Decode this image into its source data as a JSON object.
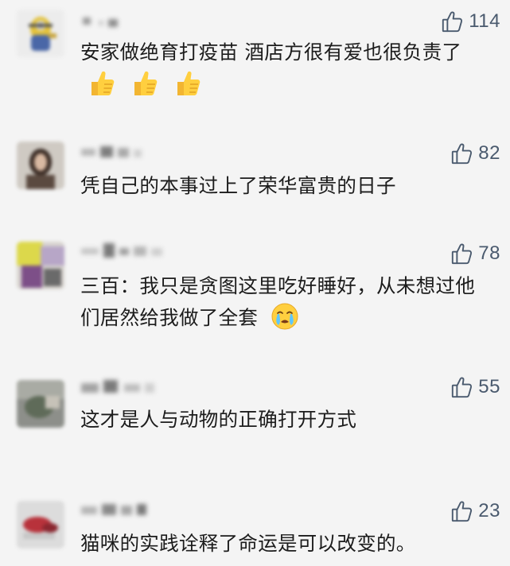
{
  "comments": [
    {
      "like_count": "114",
      "text": "安家做绝育打疫苗 酒店方很有爱也很负责了",
      "emojis": [
        "thumbs-up",
        "thumbs-up",
        "thumbs-up"
      ]
    },
    {
      "like_count": "82",
      "text": "凭自己的本事过上了荣华富贵的日子",
      "emojis": []
    },
    {
      "like_count": "78",
      "text": "三百：我只是贪图这里吃好睡好，从未想过他们居然给我做了全套",
      "emojis": [
        "crying-face"
      ]
    },
    {
      "like_count": "55",
      "text": "这才是人与动物的正确打开方式",
      "emojis": []
    },
    {
      "like_count": "23",
      "text": "猫咪的实践诠释了命运是可以改变的。",
      "emojis": []
    }
  ],
  "colors": {
    "background": "#f4f4f4",
    "text": "#1c1c1c",
    "like": "#4a5a6e"
  },
  "icons": {
    "like": "thumbs-up-outline-icon"
  }
}
